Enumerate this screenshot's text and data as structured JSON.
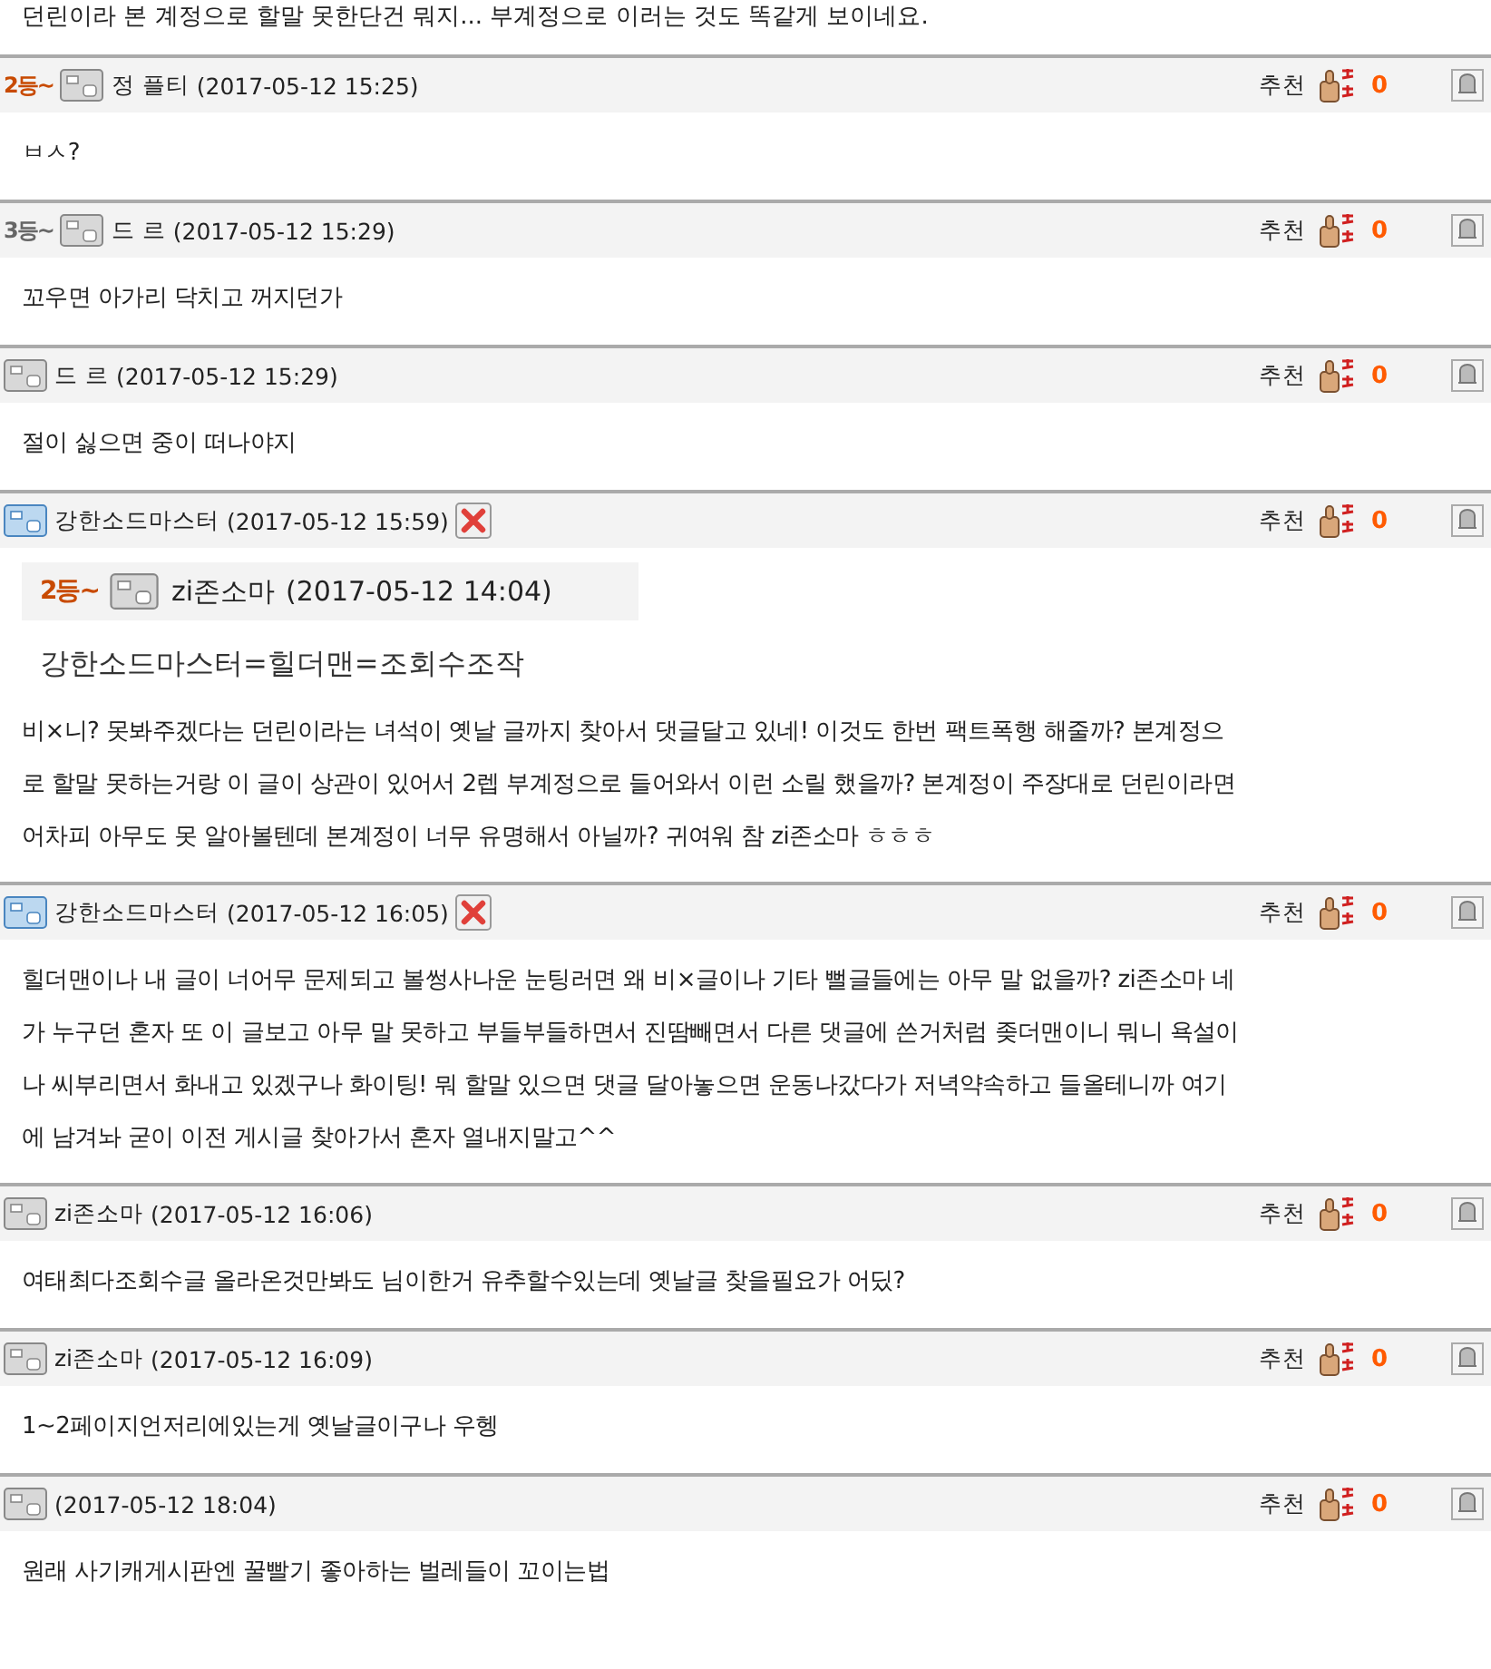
{
  "top_text": "던린이라 본 계정으로 할말 못한단건 뭐지... 부계정으로 이러는 것도 똑같게 보이네요.",
  "comments": [
    {
      "rank": {
        "text": "2등~",
        "color": "#c84a00"
      },
      "kind": "grey",
      "author": "정 플티",
      "date": "(2017-05-12 15:25)",
      "deletable": false,
      "recommend_label": "추천",
      "count": "0",
      "body": [
        "ㅂㅅ?"
      ]
    },
    {
      "rank": {
        "text": "3등~",
        "color": "#666666"
      },
      "kind": "grey",
      "author": "드 르",
      "date": "(2017-05-12 15:29)",
      "deletable": false,
      "recommend_label": "추천",
      "count": "0",
      "body": [
        "꼬우면 아가리 닥치고 꺼지던가"
      ]
    },
    {
      "kind": "grey",
      "author": "드 르",
      "date": "(2017-05-12 15:29)",
      "deletable": false,
      "recommend_label": "추천",
      "count": "0",
      "body": [
        "절이 싫으면 중이 떠나야지"
      ]
    },
    {
      "kind": "blue",
      "author": "강한소드마스터",
      "date": "(2017-05-12 15:59)",
      "deletable": true,
      "recommend_label": "추천",
      "count": "0",
      "quote": {
        "rank": {
          "text": "2등~",
          "color": "#c84a00"
        },
        "kind": "grey",
        "author": "zi존소마",
        "date": "(2017-05-12 14:04)",
        "text": "강한소드마스터=힐더맨=조회수조작"
      },
      "body": [
        "비×니? 못봐주겠다는 던린이라는 녀석이 옛날 글까지 찾아서 댓글달고 있네! 이것도 한번 팩트폭행 해줄까? 본계정으",
        "로 할말 못하는거랑 이 글이 상관이 있어서 2렙 부계정으로 들어와서 이런 소릴 했을까? 본계정이 주장대로 던린이라면",
        "어차피 아무도 못 알아볼텐데 본계정이 너무 유명해서 아닐까? 귀여워 참 zi존소마 ㅎㅎㅎ"
      ]
    },
    {
      "kind": "blue",
      "author": "강한소드마스터",
      "date": "(2017-05-12 16:05)",
      "deletable": true,
      "recommend_label": "추천",
      "count": "0",
      "body": [
        "힐더맨이나 내 글이 너어무 문제되고 볼썽사나운 눈팅러면 왜 비×글이나 기타 뻘글들에는 아무 말 없을까? zi존소마 네",
        "가 누구던 혼자 또 이 글보고 아무 말 못하고 부들부들하면서 진땀빼면서 다른 댓글에 쓴거처럼 좆더맨이니 뭐니 욕설이",
        "나 씨부리면서 화내고 있겠구나 화이팅! 뭐 할말 있으면 댓글 달아놓으면 운동나갔다가 저녁약속하고 들올테니까 여기",
        "에 남겨놔 굳이 이전 게시글 찾아가서 혼자 열내지말고^^"
      ]
    },
    {
      "kind": "grey",
      "author": "zi존소마",
      "date": "(2017-05-12 16:06)",
      "deletable": false,
      "recommend_label": "추천",
      "count": "0",
      "body": [
        "여태최다조회수글 올라온것만봐도 님이한거 유추할수있는데 옛날글 찾을필요가 어딨?"
      ]
    },
    {
      "kind": "grey",
      "author": "zi존소마",
      "date": "(2017-05-12 16:09)",
      "deletable": false,
      "recommend_label": "추천",
      "count": "0",
      "body": [
        "1~2페이지언저리에있는게 옛날글이구나 우헹"
      ]
    },
    {
      "kind": "grey",
      "date": "(2017-05-12 18:04)",
      "deletable": false,
      "recommend_label": "추천",
      "count": "0",
      "body": [
        "원래 사기캐게시판엔 꿀빨기 좋아하는 벌레들이 꼬이는법"
      ]
    }
  ]
}
